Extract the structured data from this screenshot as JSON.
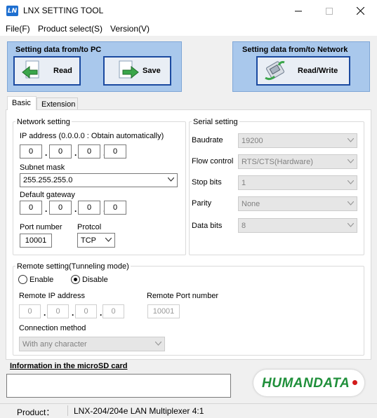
{
  "window": {
    "title": "LNX SETTING TOOL",
    "icon_text": "LN"
  },
  "menu": {
    "file": "File(F)",
    "product_select": "Product select(S)",
    "version": "Version(V)"
  },
  "pc_panel": {
    "title": "Setting data from/to PC",
    "read_label": "Read",
    "save_label": "Save"
  },
  "network_panel": {
    "title": "Setting data from/to Network",
    "readwrite_label": "Read/Write"
  },
  "tabs": {
    "basic": "Basic",
    "extension": "Extension"
  },
  "network_setting": {
    "legend": "Network setting",
    "ip_label": "IP address (0.0.0.0 : Obtain automatically)",
    "ip": [
      "0",
      "0",
      "0",
      "0"
    ],
    "subnet_label": "Subnet mask",
    "subnet_value": "255.255.255.0",
    "gateway_label": "Default gateway",
    "gateway": [
      "0",
      "0",
      "0",
      "0"
    ],
    "port_label": "Port number",
    "port_value": "10001",
    "protocol_label": "Protcol",
    "protocol_value": "TCP"
  },
  "serial_setting": {
    "legend": "Serial setting",
    "baudrate_label": "Baudrate",
    "baudrate_value": "19200",
    "flow_label": "Flow control",
    "flow_value": "RTS/CTS(Hardware)",
    "stopbits_label": "Stop bits",
    "stopbits_value": "1",
    "parity_label": "Parity",
    "parity_value": "None",
    "databits_label": "Data bits",
    "databits_value": "8"
  },
  "remote_setting": {
    "legend": "Remote setting(Tunneling mode)",
    "enable_label": "Enable",
    "disable_label": "Disable",
    "selected": "Disable",
    "remote_ip_label": "Remote IP address",
    "remote_ip": [
      "0",
      "0",
      "0",
      "0"
    ],
    "remote_port_label": "Remote Port number",
    "remote_port_value": "10001",
    "connection_label": "Connection method",
    "connection_value": "With any character"
  },
  "info": {
    "label": "Information in the microSD card",
    "value": ""
  },
  "logo": {
    "text": "HUMANDATA"
  },
  "status": {
    "product_label": "Product：",
    "product_value": "LNX-204/204e LAN Multiplexer 4:1"
  },
  "colors": {
    "panel_bg": "#a9c8ec",
    "button_border": "#1b4aa0",
    "logo_green": "#1f8f3a",
    "logo_red": "#d21a1a"
  }
}
